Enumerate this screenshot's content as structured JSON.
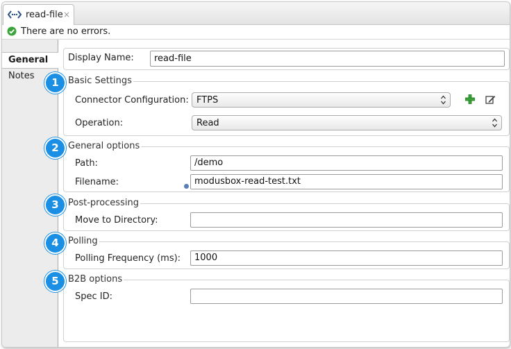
{
  "editor_tab": {
    "title": "read-file",
    "close_glyph": "×",
    "icon": "connector-icon"
  },
  "status": {
    "text": "There are no errors.",
    "icon": "check-ok-icon",
    "color": "#3aa43a"
  },
  "side_tabs": [
    {
      "label": "General",
      "active": true
    },
    {
      "label": "Notes",
      "active": false
    }
  ],
  "display_name": {
    "label": "Display Name:",
    "value": "read-file"
  },
  "sections": {
    "basic": {
      "number": "1",
      "title": "Basic Settings",
      "connector_label": "Connector Configuration:",
      "connector_value": "FTPS",
      "operation_label": "Operation:",
      "operation_value": "Read"
    },
    "general": {
      "number": "2",
      "title": "General options",
      "path_label": "Path:",
      "path_value": "/demo",
      "filename_label": "Filename:",
      "filename_value": "modusbox-read-test.txt"
    },
    "post": {
      "number": "3",
      "title": "Post-processing",
      "move_label": "Move to Directory:",
      "move_value": ""
    },
    "polling": {
      "number": "4",
      "title": "Polling",
      "freq_label": "Polling Frequency (ms):",
      "freq_value": "1000"
    },
    "b2b": {
      "number": "5",
      "title": "B2B options",
      "spec_label": "Spec ID:",
      "spec_value": ""
    }
  },
  "colors": {
    "badge": "#1a8fe3",
    "add": "#3aa43a"
  }
}
